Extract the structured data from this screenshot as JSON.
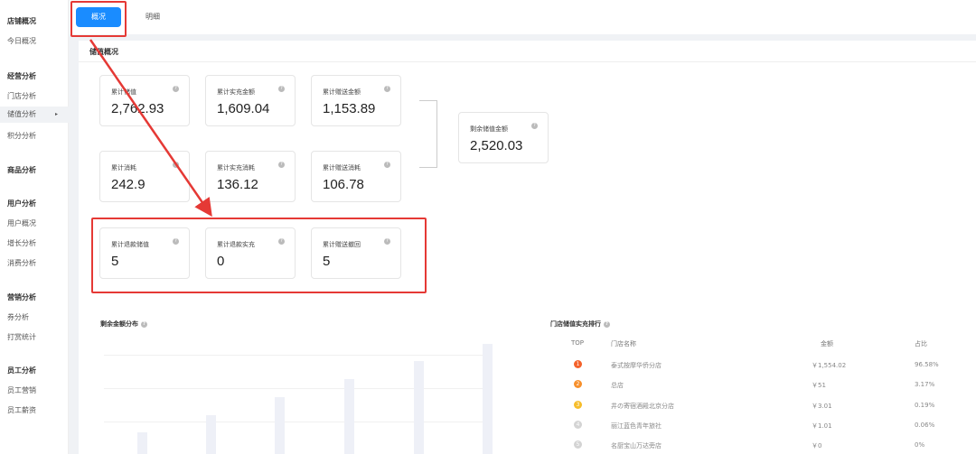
{
  "sidebar": {
    "items": [
      {
        "label": "店铺概况",
        "type": "group"
      },
      {
        "label": "今日概况",
        "type": "link"
      },
      {
        "label": "经营分析",
        "type": "group"
      },
      {
        "label": "门店分析",
        "type": "link"
      },
      {
        "label": "储值分析",
        "type": "link",
        "active": true
      },
      {
        "label": "积分分析",
        "type": "link"
      },
      {
        "label": "商品分析",
        "type": "group"
      },
      {
        "label": "用户分析",
        "type": "group"
      },
      {
        "label": "用户概况",
        "type": "link"
      },
      {
        "label": "增长分析",
        "type": "link"
      },
      {
        "label": "消费分析",
        "type": "link"
      },
      {
        "label": "营销分析",
        "type": "group"
      },
      {
        "label": "券分析",
        "type": "link"
      },
      {
        "label": "打赏统计",
        "type": "link"
      },
      {
        "label": "员工分析",
        "type": "group"
      },
      {
        "label": "员工营销",
        "type": "link"
      },
      {
        "label": "员工薪资",
        "type": "link"
      }
    ],
    "active_arrow": "▸"
  },
  "tabs": {
    "overview": "概况",
    "detail": "明细"
  },
  "section": {
    "title": "储值概况"
  },
  "cards": {
    "total_stored": {
      "label": "累计储值",
      "value": "2,762.93"
    },
    "total_recharge": {
      "label": "累计实充金额",
      "value": "1,609.04"
    },
    "total_gift": {
      "label": "累计赠送金额",
      "value": "1,153.89"
    },
    "remaining": {
      "label": "剩余储值金额",
      "value": "2,520.03"
    },
    "total_consume": {
      "label": "累计消耗",
      "value": "242.9"
    },
    "recharge_consume": {
      "label": "累计实充消耗",
      "value": "136.12"
    },
    "gift_consume": {
      "label": "累计赠送消耗",
      "value": "106.78"
    },
    "refund_stored": {
      "label": "累计退款储值",
      "value": "5"
    },
    "refund_recharge": {
      "label": "累计退款实充",
      "value": "0"
    },
    "gift_recovered": {
      "label": "累计赠送撤回",
      "value": "5"
    }
  },
  "help_glyph": "?",
  "remaining_dist": {
    "title": "剩余金额分布"
  },
  "chart_data": {
    "type": "bar",
    "title": "剩余金额分布",
    "categories": [
      "",
      "",
      "",
      "",
      "",
      ""
    ],
    "values": [
      24,
      43,
      63,
      83,
      103,
      122
    ],
    "grid": true
  },
  "ranking": {
    "title": "门店储值实充排行",
    "headers": {
      "top": "TOP",
      "name": "门店名称",
      "amount": "金额",
      "ratio": "占比"
    },
    "rows": [
      {
        "rank": "1",
        "name": "泰式按摩华侨分店",
        "amount": "￥1,554.02",
        "ratio": "96.58%",
        "color": "#f4622b"
      },
      {
        "rank": "2",
        "name": "总店",
        "amount": "￥51",
        "ratio": "3.17%",
        "color": "#f7902c"
      },
      {
        "rank": "3",
        "name": "井の寄宿酒殿北京分店",
        "amount": "￥3.01",
        "ratio": "0.19%",
        "color": "#f6bd2b"
      },
      {
        "rank": "4",
        "name": "丽江蓝色青年旅社",
        "amount": "￥1.01",
        "ratio": "0.06%",
        "color": "#d4d4d4"
      },
      {
        "rank": "5",
        "name": "名厨宝山万达旁店",
        "amount": "￥0",
        "ratio": "0%",
        "color": "#d4d4d4"
      }
    ]
  },
  "colors": {
    "accent": "#1a8cff",
    "highlight": "#e53935"
  }
}
